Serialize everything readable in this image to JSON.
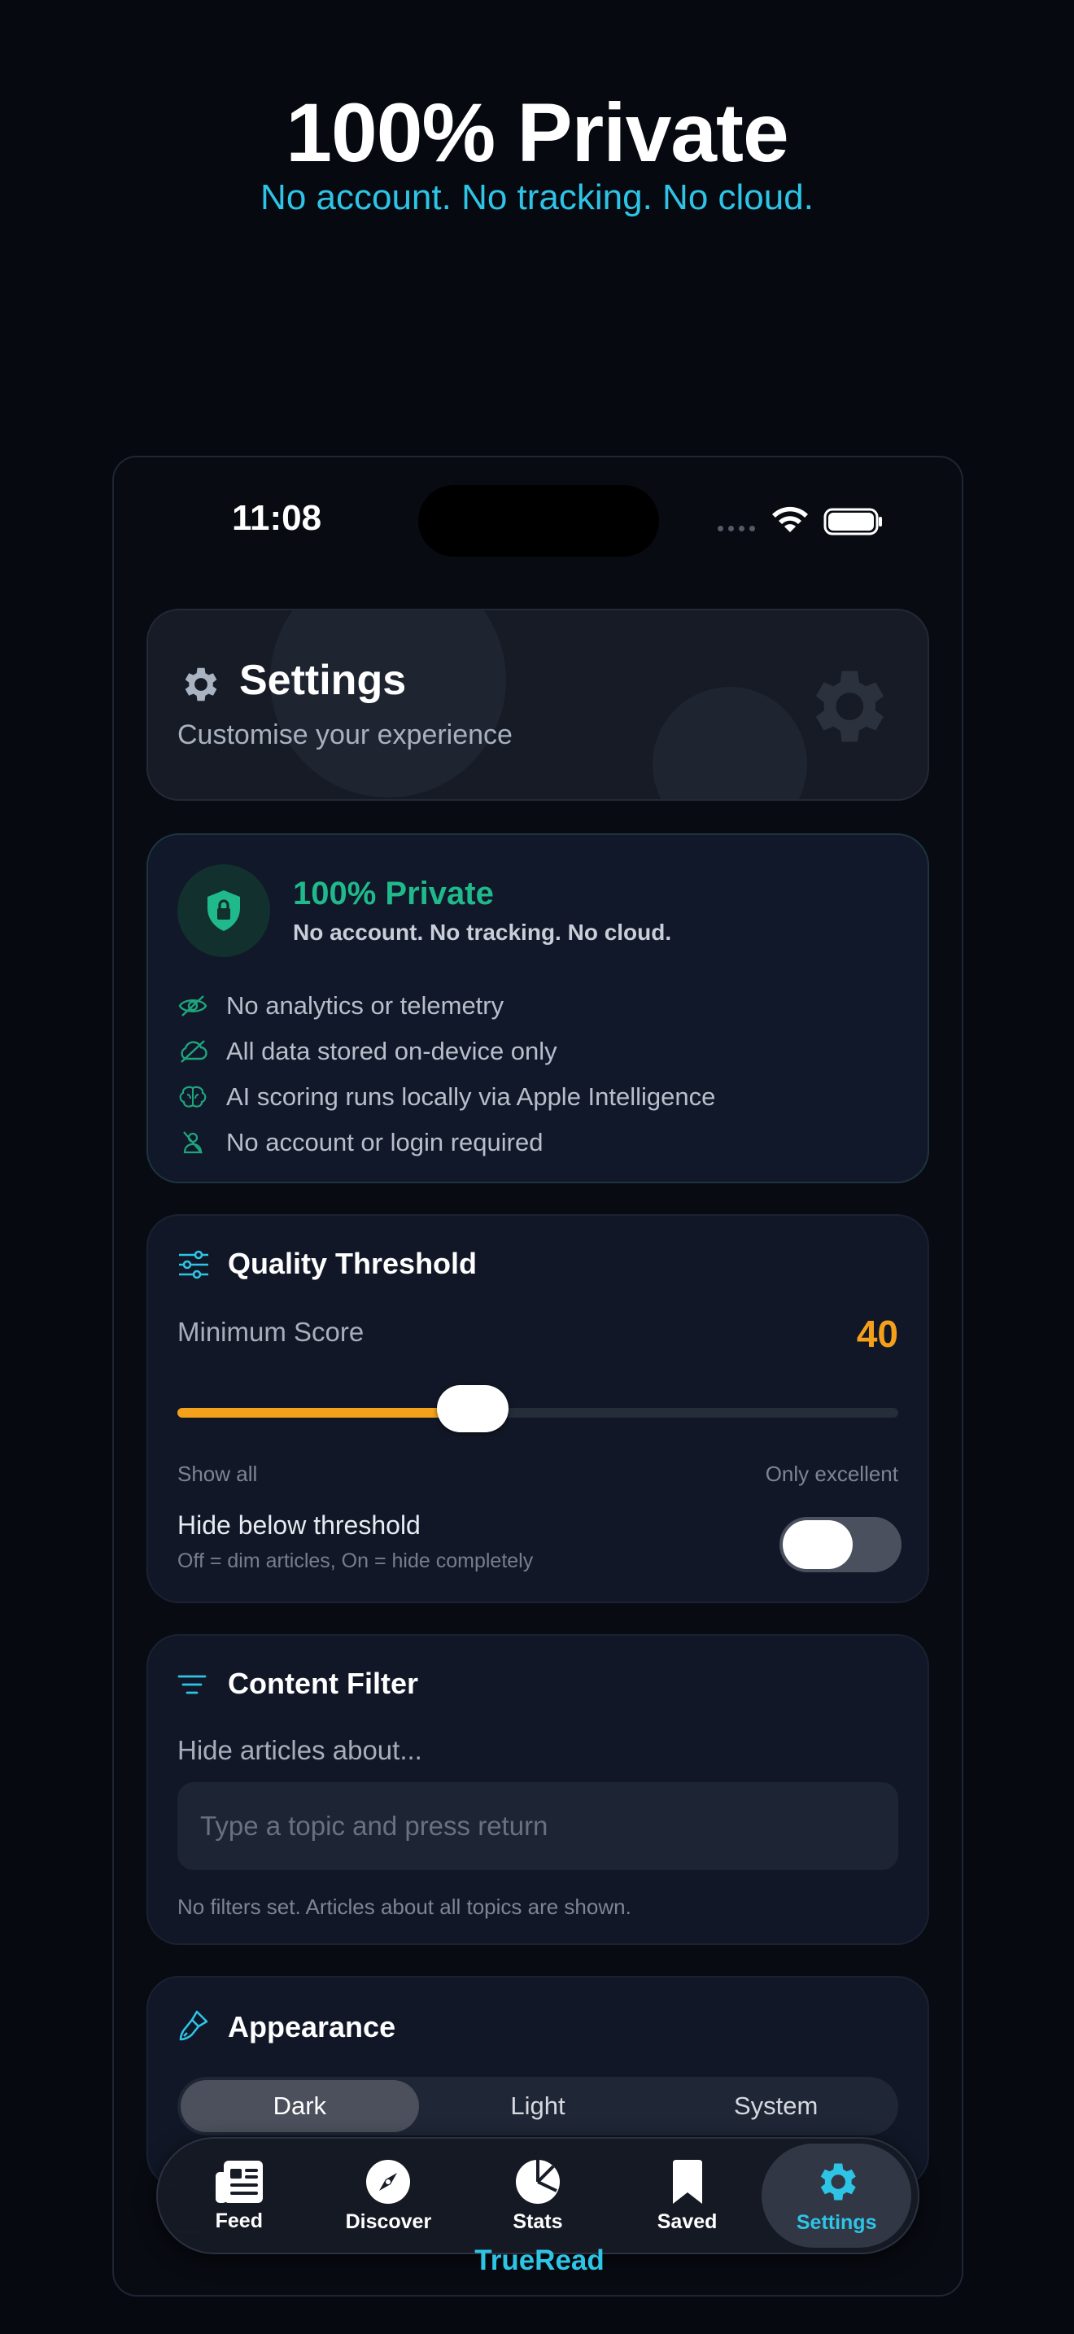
{
  "hero": {
    "title": "100% Private",
    "subtitle": "No account. No tracking. No cloud."
  },
  "status_bar": {
    "time": "11:08"
  },
  "header": {
    "title": "Settings",
    "subtitle": "Customise your experience"
  },
  "privacy": {
    "title": "100% Private",
    "subtitle": "No account. No tracking. No cloud.",
    "items": [
      {
        "icon": "eye-slash-icon",
        "label": "No analytics or telemetry"
      },
      {
        "icon": "cloud-slash-icon",
        "label": "All data stored on-device only"
      },
      {
        "icon": "brain-icon",
        "label": "AI scoring runs locally via Apple Intelligence"
      },
      {
        "icon": "person-slash-icon",
        "label": "No account or login required"
      }
    ]
  },
  "quality": {
    "title": "Quality Threshold",
    "min_label": "Minimum Score",
    "min_value": "40",
    "slider_fraction": 0.41,
    "slider_min_label": "Show all",
    "slider_max_label": "Only excellent",
    "hide_label": "Hide below threshold",
    "hide_sub": "Off = dim articles, On = hide completely",
    "hide_enabled": false
  },
  "filter": {
    "title": "Content Filter",
    "subtitle": "Hide articles about...",
    "input_placeholder": "Type a topic and press return",
    "input_value": "",
    "note": "No filters set. Articles about all topics are shown."
  },
  "appearance": {
    "title": "Appearance",
    "options": [
      "Dark",
      "Light",
      "System"
    ],
    "selected": "Dark"
  },
  "tabs": [
    {
      "label": "Feed",
      "icon": "newspaper-icon"
    },
    {
      "label": "Discover",
      "icon": "compass-icon"
    },
    {
      "label": "Stats",
      "icon": "pie-chart-icon"
    },
    {
      "label": "Saved",
      "icon": "bookmark-icon"
    },
    {
      "label": "Settings",
      "icon": "gear-icon",
      "active": true
    }
  ],
  "brand": "TrueRead",
  "colors": {
    "accent": "#2ec4e6",
    "privacy_green": "#1fb98b",
    "score_orange": "#f5a01a",
    "background": "#06090f"
  }
}
